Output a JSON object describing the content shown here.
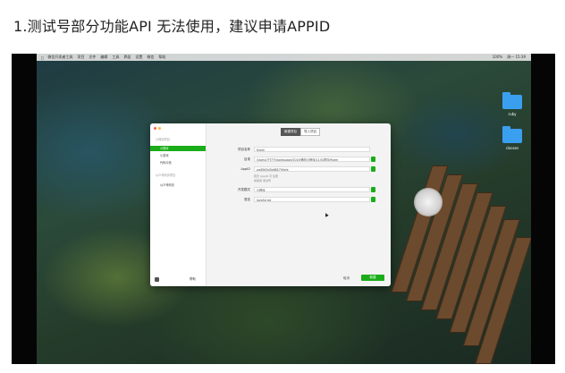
{
  "caption": "1.测试号部分功能API 无法使用，建议申请APPID",
  "menubar": {
    "app": "微信开发者工具",
    "menus": [
      "项目",
      "文件",
      "编辑",
      "工具",
      "界面",
      "设置",
      "微信",
      "帮助"
    ],
    "status": [
      "100%",
      "周一 15:39"
    ]
  },
  "desktop_folders": [
    {
      "label": "ruby"
    },
    {
      "label": "classes"
    }
  ],
  "dialog": {
    "tabs": [
      {
        "label": "新建项目",
        "active": true
      },
      {
        "label": "导入项目",
        "active": false
      }
    ],
    "sidebar": {
      "group1": "小程序项目",
      "items": [
        {
          "label": "小程序",
          "active": true
        },
        {
          "label": "小游戏",
          "active": false
        },
        {
          "label": "代码片段",
          "active": false
        }
      ],
      "group2": "公众号网页项目",
      "items2": [
        {
          "label": "公众号网页",
          "active": false
        }
      ],
      "footer_label": "帮助"
    },
    "form": {
      "project_name": {
        "label": "项目名称",
        "value": "fivem"
      },
      "directory": {
        "label": "目录",
        "value": "/Users/??????/workspace/2019/微信小程序/11/5/项目/fivem"
      },
      "appid": {
        "label": "AppID",
        "value": "wx8565d3e885790cfe"
      },
      "hint_line1": "若无 AppID 可 注册",
      "hint_line2": "或使用 测试号",
      "backend": {
        "label": "开发模式",
        "value": "小程序"
      },
      "language": {
        "label": "语言",
        "value": "JavaScript"
      }
    },
    "cancel_label": "取消",
    "confirm_label": "新建"
  },
  "colors": {
    "accent": "#1aad19",
    "link": "#4a6ee0"
  }
}
